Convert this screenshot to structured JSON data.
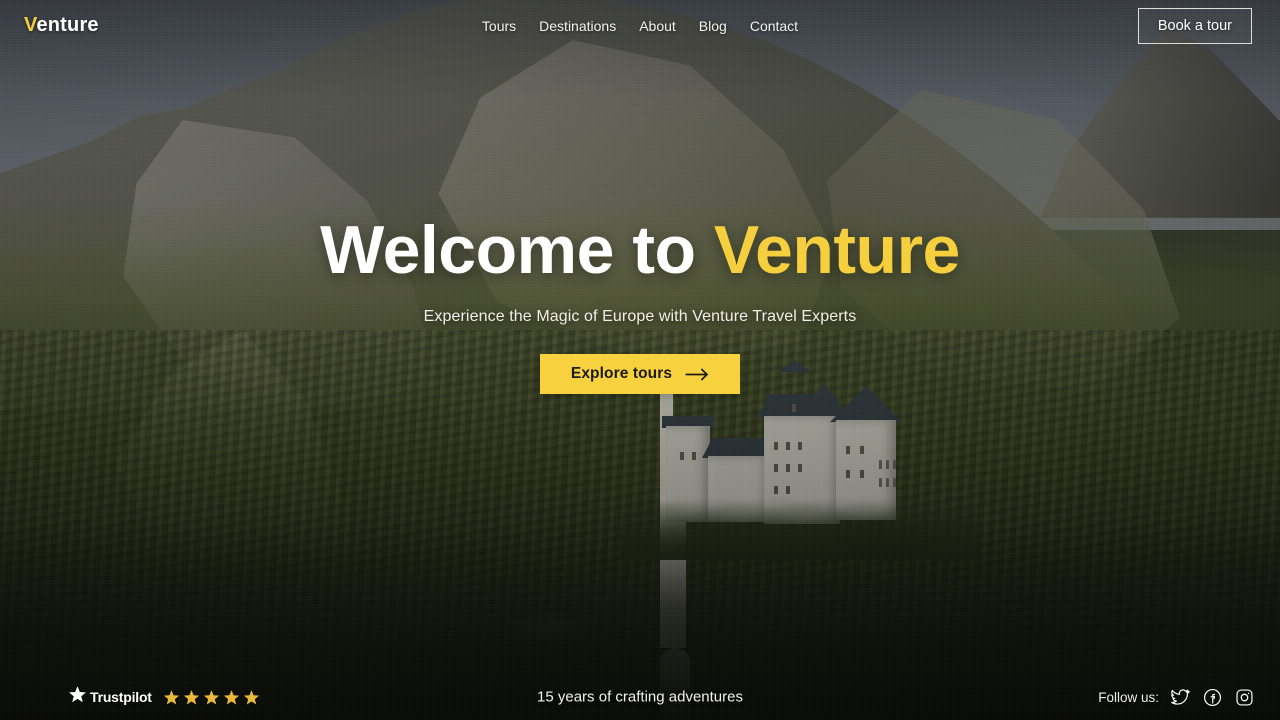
{
  "site": {
    "brand_prefix": "V",
    "brand_rest": "enture",
    "brand_full": "Venture"
  },
  "colors": {
    "accent_yellow": "#F8D13F",
    "heading_white": "#FFFFFF",
    "cta_text": "#1B1B17",
    "sky": "#626A72"
  },
  "header": {
    "nav": [
      {
        "label": "Tours"
      },
      {
        "label": "Destinations"
      },
      {
        "label": "About"
      },
      {
        "label": "Blog"
      },
      {
        "label": "Contact"
      }
    ],
    "book_button": "Book a tour"
  },
  "hero": {
    "title_plain": "Welcome to",
    "title_accent": "Venture",
    "subtitle": "Experience the Magic of Europe with Venture Travel Experts",
    "cta_label": "Explore tours",
    "cta_icon": "arrow-right-icon"
  },
  "bottom": {
    "trustpilot": {
      "label": "Trustpilot",
      "logo_icon": "trustpilot-star-icon",
      "rating": 5,
      "stars": [
        1,
        2,
        3,
        4,
        5
      ]
    },
    "tagline": "15 years of crafting adventures",
    "follow": {
      "label": "Follow us:",
      "socials": [
        {
          "name": "twitter-icon"
        },
        {
          "name": "facebook-icon"
        },
        {
          "name": "instagram-icon"
        }
      ]
    }
  }
}
